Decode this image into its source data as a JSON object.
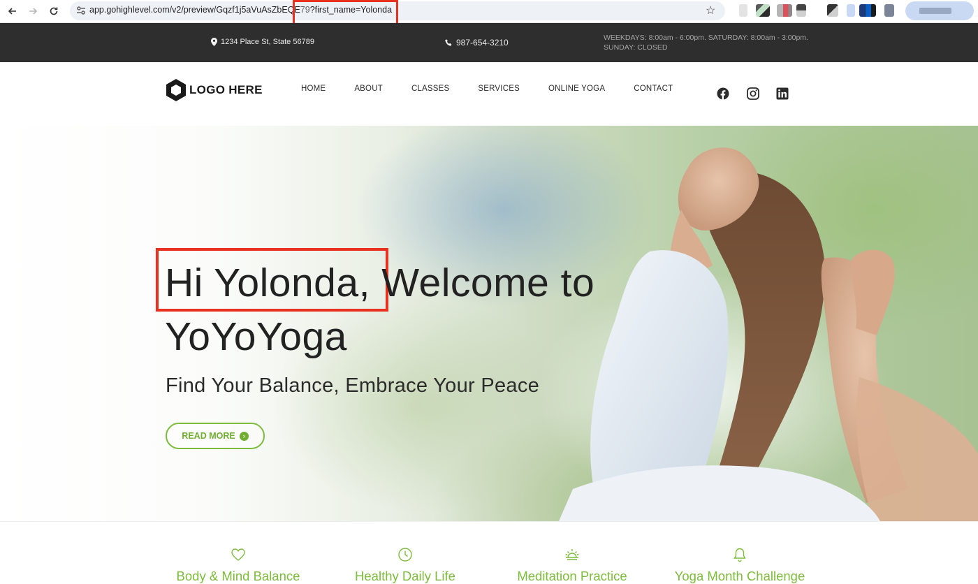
{
  "browser": {
    "url_main": "app.gohighlevel.com/v2/preview/Gqzf1j5aVuAsZbEQE",
    "url_cut": "79",
    "url_query": "?first_name=Yolonda"
  },
  "topbar": {
    "address": "1234 Place St, State 56789",
    "phone": "987-654-3210",
    "hours_line1": "WEEKDAYS: 8:00am - 6:00pm. SATURDAY: 8:00am - 3:00pm.",
    "hours_line2": "SUNDAY: CLOSED"
  },
  "header": {
    "logo_text": "LOGO HERE",
    "menu": [
      "HOME",
      "ABOUT",
      "CLASSES",
      "SERVICES",
      "ONLINE YOGA",
      "CONTACT"
    ],
    "social_icons": [
      "facebook-icon",
      "instagram-icon",
      "linkedin-icon"
    ]
  },
  "hero": {
    "greeting": "Hi Yolonda,",
    "title_rest": " Welcome to YoYoYoga",
    "subtitle": "Find Your Balance, Embrace Your Peace",
    "cta_label": "READ MORE"
  },
  "features": [
    {
      "label": "Body & Mind Balance",
      "icon": "heart-icon"
    },
    {
      "label": "Healthy Daily Life",
      "icon": "clock-icon"
    },
    {
      "label": "Meditation Practice",
      "icon": "sunrise-icon"
    },
    {
      "label": "Yoga Month Challenge",
      "icon": "bell-icon"
    }
  ],
  "colors": {
    "accent_green": "#7dbb3c",
    "topbar_bg": "#2e2e2e",
    "highlight_red": "#e8321f"
  }
}
